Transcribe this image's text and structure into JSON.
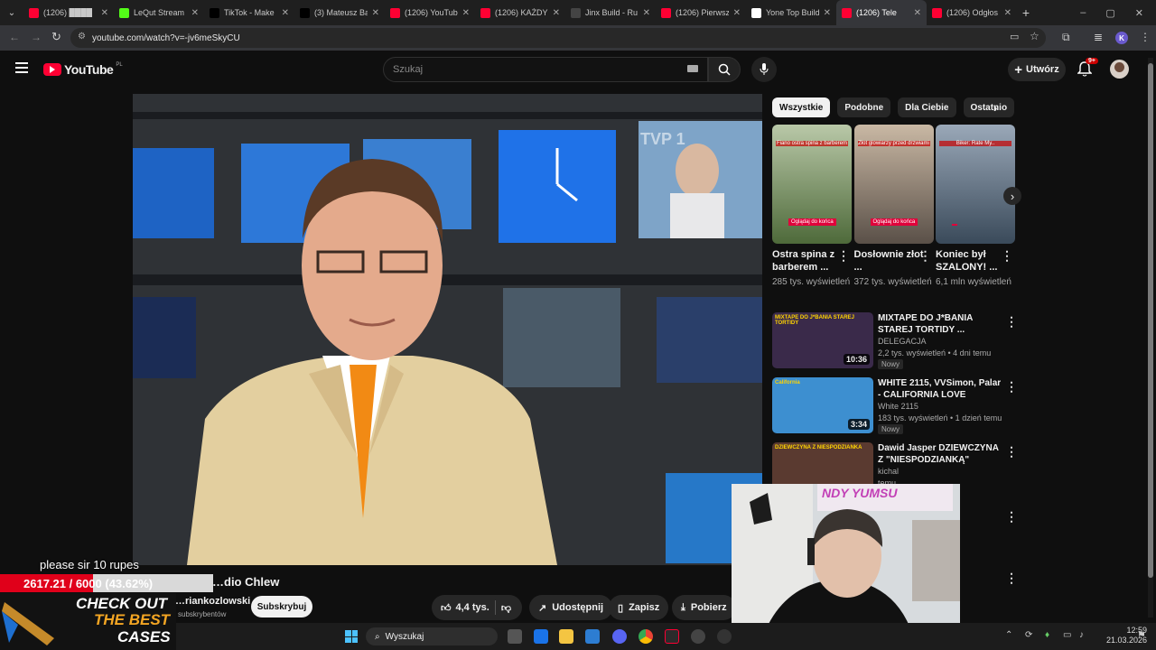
{
  "browser": {
    "tabs": [
      {
        "label": "(1206) ████",
        "color": "#ff0033",
        "icon": "youtube-icon"
      },
      {
        "label": "LeQut Stream",
        "color": "#53fc18",
        "icon": "kick-icon"
      },
      {
        "label": "TikTok - Make",
        "color": "#000000",
        "icon": "tiktok-icon"
      },
      {
        "label": "(3) Mateusz Ba",
        "color": "#000000",
        "icon": "x-icon"
      },
      {
        "label": "(1206) YouTube",
        "color": "#ff0033",
        "icon": "youtube-icon"
      },
      {
        "label": "(1206) KAŻDY",
        "color": "#ff0033",
        "icon": "youtube-icon"
      },
      {
        "label": "Jinx Build - Ru",
        "color": "#444444",
        "icon": "page-icon"
      },
      {
        "label": "(1206) Pierwsz",
        "color": "#ff0033",
        "icon": "youtube-icon"
      },
      {
        "label": "Yone Top Build",
        "color": "#ffffff",
        "icon": "page-icon"
      },
      {
        "label": "(1206) Tele",
        "color": "#ff0033",
        "icon": "youtube-icon"
      },
      {
        "label": "(1206) Odgłos",
        "color": "#ff0033",
        "icon": "youtube-icon"
      }
    ],
    "url": "youtube.com/watch?v=-jv6meSkyCU",
    "profile": "K"
  },
  "yt": {
    "logo": "YouTube",
    "region": "PL",
    "search_placeholder": "Szukaj",
    "create": "Utwórz",
    "notif": "9+"
  },
  "chips": [
    "Wszystkie",
    "Podobne",
    "Dla Ciebie",
    "Ostatnio"
  ],
  "shorts": [
    {
      "title": "Ostra spina z barberem ...",
      "views": "285 tys. wyświetleń",
      "overlay": "Fiano ostra spina z barberem",
      "bottom": "Oglądaj do końca"
    },
    {
      "title": "Dosłownie złot ...",
      "views": "372 tys. wyświetleń",
      "overlay": "Złot glowiarzy przed drzwiami",
      "bottom": "Oglądaj do końca"
    },
    {
      "title": "Koniec był SZALONY! ...",
      "views": "6,1 mln wyświetleń",
      "overlay": "Biker: Rate My..",
      "bottom": ""
    }
  ],
  "recs": [
    {
      "title": "MIXTAPE DO J*BANIA STAREJ TORTIDY ...",
      "channel": "DELEGACJA",
      "meta": "2,2 tys. wyświetleń • 4 dni temu",
      "badge": "Nowy",
      "duration": "10:36",
      "thumb": "MIXTAPE DO J*BANIA STAREJ TORTIDY"
    },
    {
      "title": "WHITE 2115, VVSimon, Palar - CALIFORNIA LOVE",
      "channel": "White 2115",
      "meta": "183 tys. wyświetleń • 1 dzień temu",
      "badge": "Nowy",
      "duration": "3:34",
      "thumb": "California"
    },
    {
      "title": "Dawid Jasper DZIEWCZYNA Z \"NIESPODZIANKĄ\"",
      "channel": "kichal",
      "meta": "temu",
      "badge": "",
      "duration": "",
      "thumb": "DZIEWCZYNA Z NIESPODZIANKA"
    },
    {
      "title": "…usic",
      "channel": "",
      "meta": "temu",
      "badge": "",
      "duration": "",
      "thumb": ""
    },
    {
      "title": "…Szachta …enis ...",
      "channel": "",
      "meta": "…godzin temu",
      "badge": "",
      "duration": "",
      "thumb": ""
    }
  ],
  "video": {
    "channel_partial": "…dio Chlew",
    "owner_partial": "…riankozlowski",
    "subs": "subskrybentów",
    "subscribe": "Subskrybuj",
    "likes": "4,4 tys.",
    "share": "Udostępnij",
    "save": "Zapisz",
    "download": "Pobierz",
    "watermark": "TVP 1"
  },
  "overlay": {
    "donation": "please sir 10 rupes",
    "progress_text": "2617.21 / 6000 (43.62%)",
    "progress": 0.4362,
    "promo1": "CHECK OUT",
    "promo2": "THE BEST",
    "promo3": "CASES",
    "cam_text": "NDY YUMSU"
  },
  "taskbar": {
    "search": "Wyszukaj",
    "time": "12:59",
    "date": "21.03.2026"
  }
}
